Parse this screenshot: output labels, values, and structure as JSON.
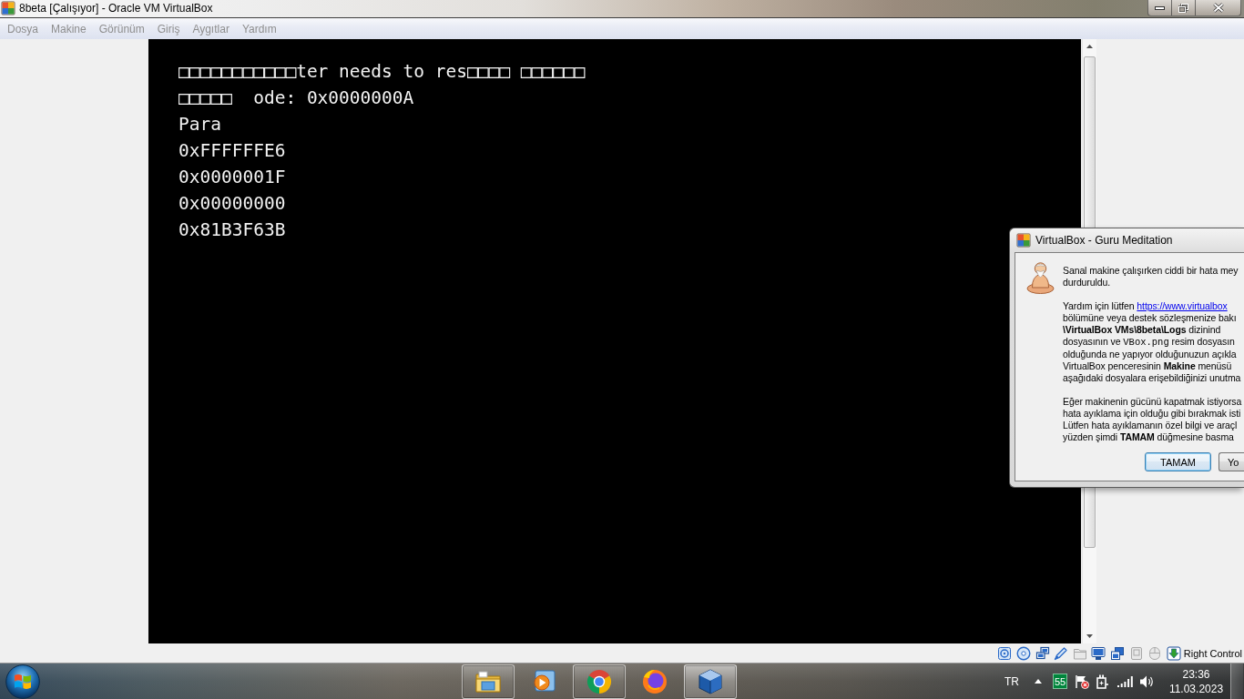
{
  "window": {
    "title": "8beta [Çalışıyor] - Oracle VM VirtualBox"
  },
  "menu": [
    {
      "label": "Dosya",
      "disabled": true
    },
    {
      "label": "Makine",
      "disabled": true
    },
    {
      "label": "Görünüm",
      "disabled": true
    },
    {
      "label": "Giriş",
      "disabled": true
    },
    {
      "label": "Aygıtlar",
      "disabled": true
    },
    {
      "label": "Yardım",
      "disabled": true
    }
  ],
  "vm_screen": {
    "lines": [
      "□□□□□□□□□□□ter needs to res□□□□ □□□□□□",
      "□□□□□  ode: 0x0000000A",
      "Para",
      "0xFFFFFFE6",
      "0x0000001F",
      "0x00000000",
      "0x81B3F63B"
    ]
  },
  "dialog": {
    "title": "VirtualBox - Guru Meditation",
    "paragraphs": [
      {
        "lines": [
          [
            {
              "kind": "text",
              "text": "Sanal makine çalışırken ciddi bir hata mey"
            }
          ],
          [
            {
              "kind": "text",
              "text": "durduruldu."
            }
          ]
        ]
      },
      {
        "lines": [
          [
            {
              "kind": "text",
              "text": "Yardım için lütfen "
            },
            {
              "kind": "link",
              "text": "https://www.virtualbox"
            }
          ],
          [
            {
              "kind": "text",
              "text": "bölümüne veya destek sözleşmenize bakı"
            }
          ],
          [
            {
              "kind": "text",
              "text": "**\\VirtualBox VMs\\8beta\\Logs** dizinind"
            }
          ],
          [
            {
              "kind": "text",
              "text": "dosyasının ve "
            },
            {
              "kind": "code",
              "text": "VBox.png"
            },
            {
              "kind": "text",
              "text": " resim dosyasın"
            }
          ],
          [
            {
              "kind": "text",
              "text": "olduğunda ne yapıyor olduğunuzun açıkla"
            }
          ],
          [
            {
              "kind": "text",
              "text": "VirtualBox penceresinin **Makine** menüsü"
            }
          ],
          [
            {
              "kind": "text",
              "text": "aşağıdaki dosyalara erişebildiğinizi unutma"
            }
          ]
        ]
      },
      {
        "lines": [
          [
            {
              "kind": "text",
              "text": "Eğer makinenin gücünü kapatmak istiyorsa"
            }
          ],
          [
            {
              "kind": "text",
              "text": "hata ayıklama için olduğu gibi bırakmak isti"
            }
          ],
          [
            {
              "kind": "text",
              "text": "Lütfen hata ayıklamanın özel bilgi ve araçl"
            }
          ],
          [
            {
              "kind": "text",
              "text": "yüzden şimdi **TAMAM** düğmesine basma"
            }
          ]
        ]
      }
    ],
    "buttons": [
      {
        "label": "TAMAM",
        "default": true
      },
      {
        "label": "Yo",
        "default": false
      }
    ]
  },
  "status_bar": {
    "indicators": [
      {
        "kind": "hard-disk",
        "active": true
      },
      {
        "kind": "optical",
        "active": true
      },
      {
        "kind": "network",
        "active": true
      },
      {
        "kind": "usb",
        "active": true
      },
      {
        "kind": "shared-folder",
        "active": false
      },
      {
        "kind": "display",
        "active": true
      },
      {
        "kind": "capture",
        "active": true
      },
      {
        "kind": "cpu",
        "active": false
      },
      {
        "kind": "mouse",
        "active": false
      },
      {
        "kind": "keyboard",
        "active": true
      }
    ],
    "host_key": "Right Control"
  },
  "taskbar": {
    "apps": [
      {
        "kind": "explorer",
        "running": true,
        "selected": false
      },
      {
        "kind": "media-player",
        "running": false,
        "selected": false
      },
      {
        "kind": "chrome",
        "running": true,
        "selected": false
      },
      {
        "kind": "firefox",
        "running": false,
        "selected": false
      },
      {
        "kind": "virtualbox",
        "running": true,
        "selected": true
      }
    ],
    "language": "TR",
    "tray_counter": "55",
    "time": "23:36",
    "date": "11.03.2023"
  }
}
